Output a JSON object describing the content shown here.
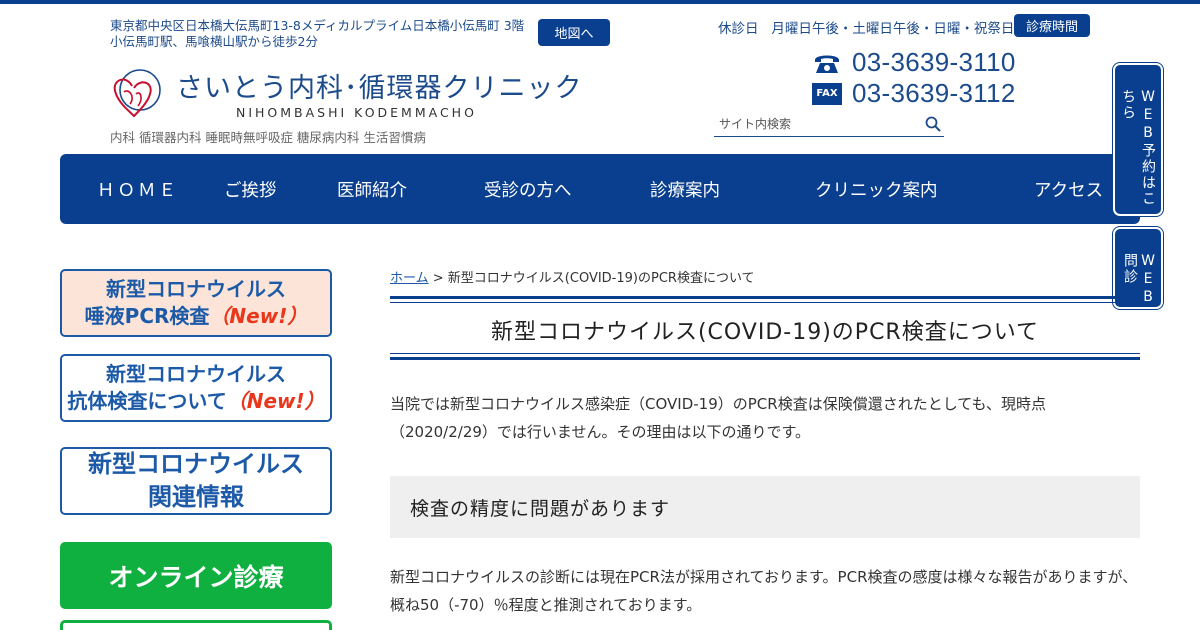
{
  "header": {
    "address_line1": "東京都中央区日本橋大伝馬町13-8メディカルプライム日本橋小伝馬町 3階",
    "address_line2": "小伝馬町駅、馬喰横山駅から徒歩2分",
    "map_button": "地図へ",
    "clinic_name": "さいとう内科･循環器クリニック",
    "clinic_sub": "NIHOMBASHI KODEMMACHO",
    "tagline": "内科 循環器内科 睡眠時無呼吸症 糖尿病内科 生活習慣病",
    "closed_label": "休診日",
    "closed_days": "月曜日午後・土曜日午後・日曜・祝祭日",
    "hours_button": "診療時間",
    "tel": "03-3639-3110",
    "fax_label": "FAX",
    "fax": "03-3639-3112",
    "search_placeholder": "サイト内検索",
    "icons": {
      "logo": "heart-circle-logo-icon",
      "phone": "telephone-icon",
      "fax": "fax-icon",
      "search": "search-icon"
    },
    "colors": {
      "brand_blue": "#0a3f8f",
      "text_blue": "#1c4b8c",
      "logo_red": "#c8102e"
    }
  },
  "nav": {
    "items": [
      {
        "label": "ＨＯＭＥ"
      },
      {
        "label": "ご挨拶"
      },
      {
        "label": "医師紹介"
      },
      {
        "label": "受診の方へ"
      },
      {
        "label": "診療案内"
      },
      {
        "label": "クリニック案内"
      },
      {
        "label": "アクセス"
      }
    ]
  },
  "side_tabs": [
    {
      "label": "WEB予約はこちら"
    },
    {
      "label": "WEB問診"
    }
  ],
  "sidebar": {
    "banners": [
      {
        "line1": "新型コロナウイルス",
        "line2": "唾液PCR検査",
        "tag": "（New!）",
        "bg": "#fce5d8",
        "border": "#1c5aa8"
      },
      {
        "line1": "新型コロナウイルス",
        "line2": "抗体検査について",
        "tag": "（New!）",
        "bg": "#ffffff",
        "border": "#1c5aa8"
      },
      {
        "line1": "新型コロナウイルス",
        "line2": "関連情報",
        "tag": "",
        "bg": "#ffffff",
        "border": "#1c5aa8"
      },
      {
        "line1": "オンライン診療",
        "line2": "",
        "tag": "",
        "bg": "#10b040",
        "border": "#10b040"
      }
    ]
  },
  "main": {
    "breadcrumb_home": "ホーム",
    "breadcrumb_sep": " > ",
    "breadcrumb_current": "新型コロナウイルス(COVID-19)のPCR検査について",
    "title": "新型コロナウイルス(COVID-19)のPCR検査について",
    "intro": "当院では新型コロナウイルス感染症（COVID-19）のPCR検査は保険償還されたとしても、現時点（2020/2/29）では行いません。その理由は以下の通りです。",
    "section1_heading": "検査の精度に問題があります",
    "section1_body": "新型コロナウイルスの診断には現在PCR法が採用されております。PCR検査の感度は様々な報告がありますが、概ね50（-70）％程度と推測されております。"
  }
}
